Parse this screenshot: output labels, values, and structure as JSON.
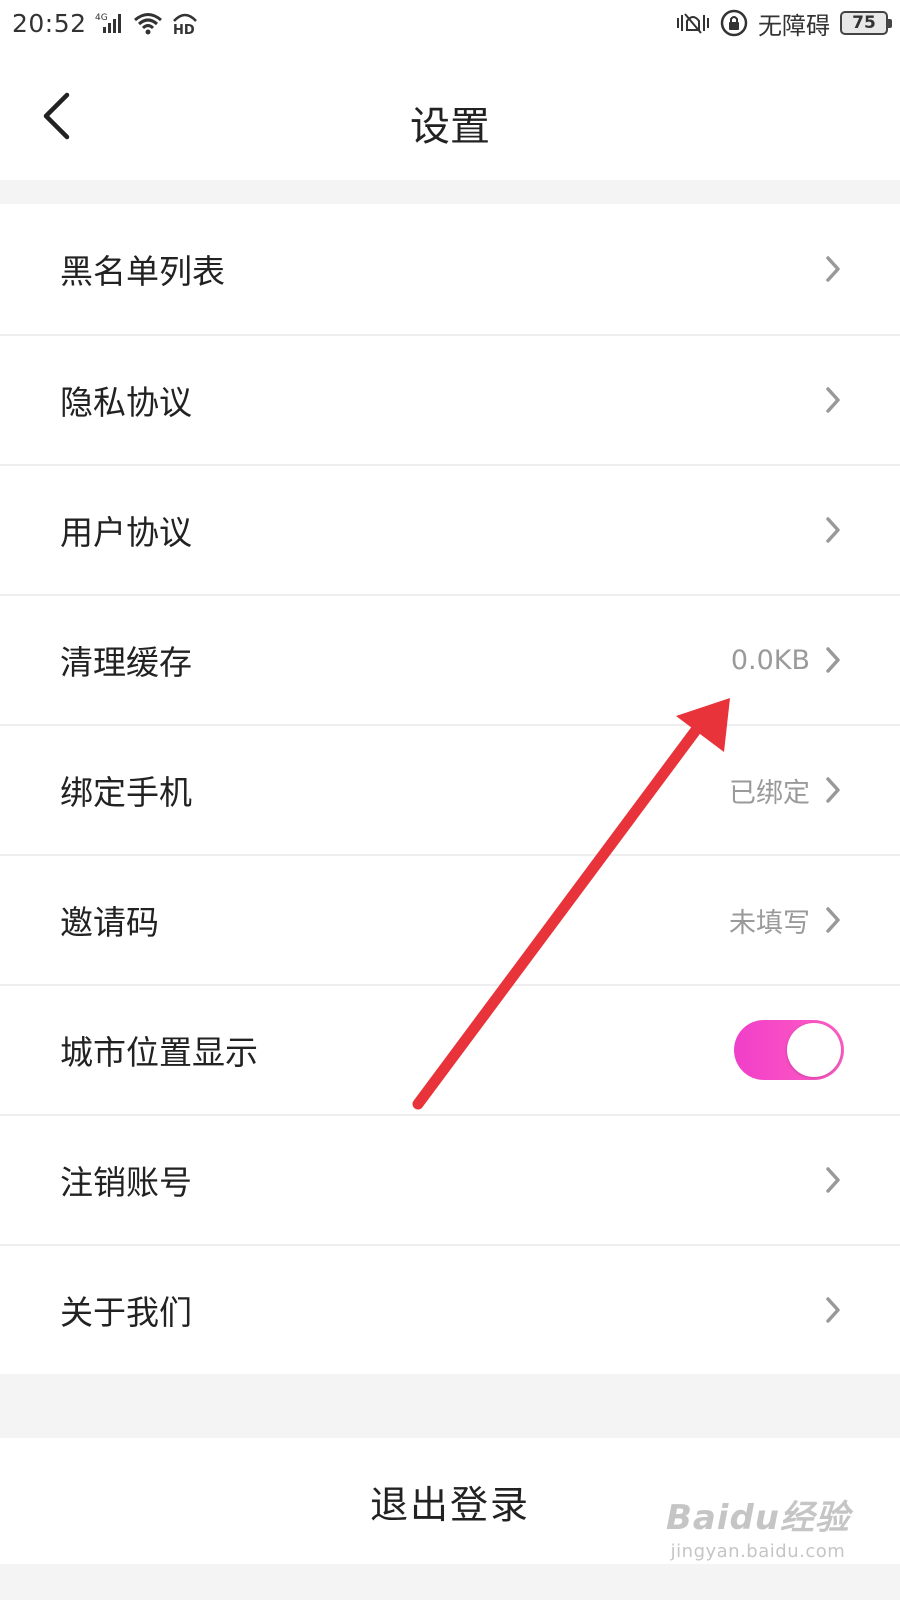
{
  "status_bar": {
    "time": "20:52",
    "network": "4G",
    "hd": "HD",
    "accessibility": "无障碍",
    "battery": "75"
  },
  "header": {
    "title": "设置",
    "back_icon": "chevron-left-icon"
  },
  "settings": {
    "items": [
      {
        "label": "黑名单列表",
        "value": ""
      },
      {
        "label": "隐私协议",
        "value": ""
      },
      {
        "label": "用户协议",
        "value": ""
      },
      {
        "label": "清理缓存",
        "value": "0.0KB"
      },
      {
        "label": "绑定手机",
        "value": "已绑定"
      },
      {
        "label": "邀请码",
        "value": "未填写"
      },
      {
        "label": "城市位置显示",
        "toggle": true
      },
      {
        "label": "注销账号",
        "value": ""
      },
      {
        "label": "关于我们",
        "value": ""
      }
    ]
  },
  "logout": {
    "label": "退出登录"
  },
  "colors": {
    "toggle_on": "#f03fc8",
    "arrow": "#e8333a",
    "value_text": "#9a9a9a"
  },
  "watermark": {
    "logo": "Baidu经验",
    "url": "jingyan.baidu.com"
  }
}
